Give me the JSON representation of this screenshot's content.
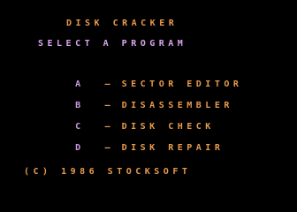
{
  "title": "DISK CRACKER",
  "subtitle": "SELECT A PROGRAM",
  "menu": [
    {
      "key": "A",
      "dash": "—",
      "label": "SECTOR EDITOR"
    },
    {
      "key": "B",
      "dash": "—",
      "label": "DISASSEMBLER"
    },
    {
      "key": "C",
      "dash": "—",
      "label": "DISK CHECK"
    },
    {
      "key": "D",
      "dash": "—",
      "label": "DISK REPAIR"
    }
  ],
  "footer": "(C) 1986 STOCKSOFT",
  "colors": {
    "background": "#000000",
    "orange": "#e89a4e",
    "lavender": "#c99be2"
  }
}
